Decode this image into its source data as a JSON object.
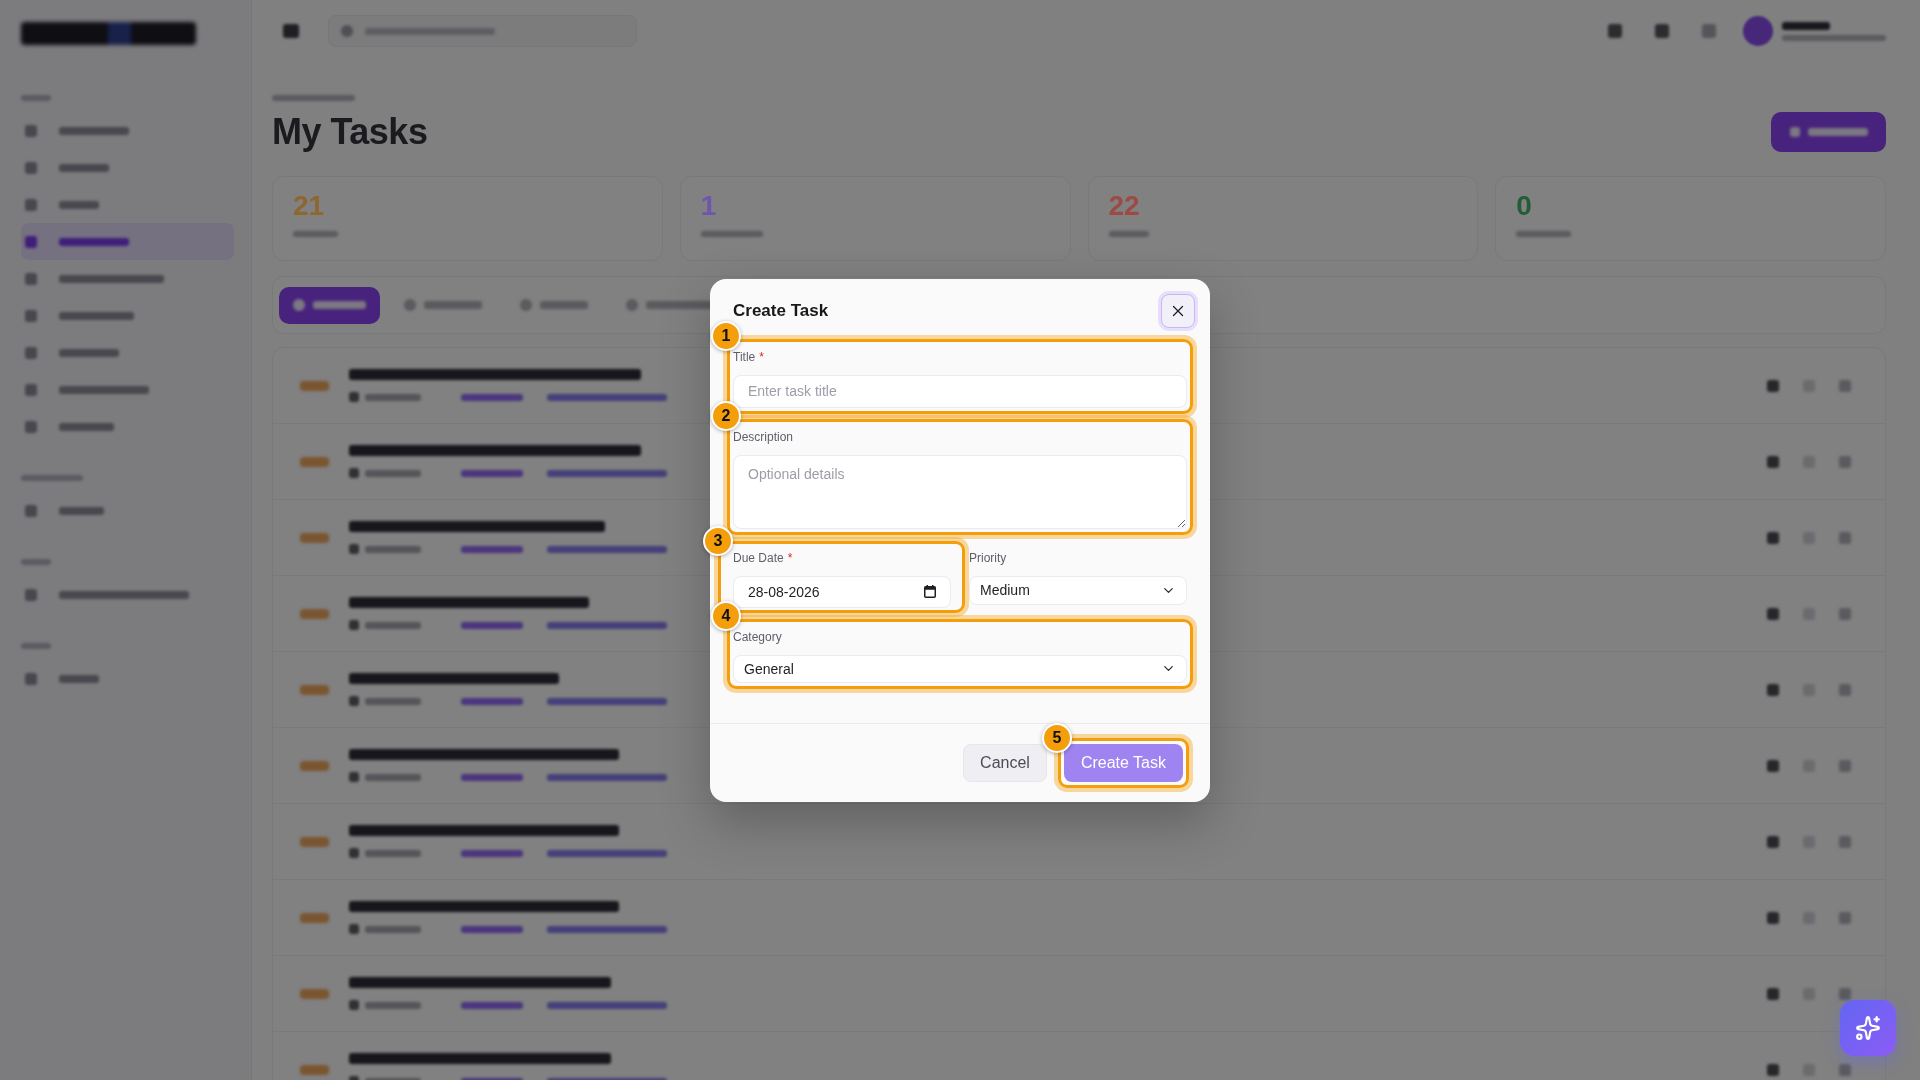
{
  "sidebar": {
    "groups": [
      {
        "items": [
          {
            "selected": false
          },
          {
            "selected": false
          },
          {
            "selected": false
          },
          {
            "selected": true
          },
          {
            "selected": false
          },
          {
            "selected": false
          },
          {
            "selected": false
          },
          {
            "selected": false
          },
          {
            "selected": false
          }
        ]
      },
      {
        "items": [
          {
            "selected": false
          }
        ]
      },
      {
        "items": [
          {
            "selected": false
          }
        ]
      },
      {
        "items": [
          {
            "selected": false
          }
        ]
      }
    ]
  },
  "page": {
    "title": "My Tasks"
  },
  "stats": [
    {
      "value": "21",
      "color": "#8e6630"
    },
    {
      "value": "1",
      "color": "#6f55b0"
    },
    {
      "value": "22",
      "color": "#9c4a44"
    },
    {
      "value": "0",
      "color": "#235c36"
    }
  ],
  "filter_tabs": [
    {
      "selected": true
    },
    {
      "selected": false
    },
    {
      "selected": false
    },
    {
      "selected": false
    }
  ],
  "modal": {
    "title": "Create Task",
    "rows": [
      {
        "fields": [
          {
            "kind": "text",
            "label": "Title",
            "required_mark": "*",
            "placeholder": "Enter task title",
            "callout": "1"
          }
        ]
      },
      {
        "fields": [
          {
            "kind": "textarea",
            "label": "Description",
            "placeholder": "Optional details",
            "callout": "2"
          }
        ]
      },
      {
        "fields": [
          {
            "kind": "date",
            "label": "Due Date",
            "required_mark": "*",
            "value": "28-08-2026",
            "callout": "3"
          },
          {
            "kind": "select",
            "label": "Priority",
            "value": "Medium"
          }
        ]
      },
      {
        "fields": [
          {
            "kind": "select",
            "label": "Category",
            "value": "General",
            "callout": "4"
          }
        ]
      }
    ],
    "buttons": [
      {
        "kind": "secondary",
        "label": "Cancel",
        "disabled": false
      },
      {
        "kind": "primary",
        "label": "Create Task",
        "disabled": true,
        "callout": "5"
      }
    ]
  }
}
